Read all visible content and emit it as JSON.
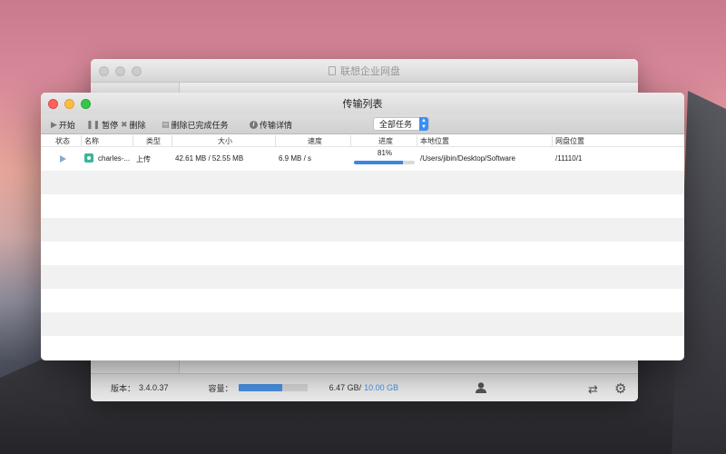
{
  "back_window": {
    "title": "联想企业网盘",
    "footer": {
      "version_label": "版本：",
      "version_value": "3.4.0.37",
      "capacity_label": "容量：",
      "capacity_fraction": 0.64,
      "capacity_used": "6.47 GB/",
      "capacity_total": "10.00 GB"
    }
  },
  "window": {
    "title": "传输列表"
  },
  "toolbar": {
    "start_label": "开始",
    "pause_label": "暂停",
    "delete_label": "删除",
    "delete_completed_label": "删除已完成任务",
    "details_label": "传输详情",
    "filter_value": "全部任务"
  },
  "table": {
    "headers": {
      "status": "状态",
      "name": "名称",
      "type": "类型",
      "size": "大小",
      "speed": "速度",
      "progress": "进度",
      "local_path": "本地位置",
      "cloud_path": "网盘位置"
    },
    "rows": [
      {
        "name": "charles-...",
        "type": "上传",
        "size": "42.61 MB / 52.55 MB",
        "speed": "6.9 MB / s",
        "progress_text": "81%",
        "progress_fraction": 0.81,
        "local_path": "/Users/jibin/Desktop/Software",
        "cloud_path": "/11110/1"
      }
    ]
  },
  "colors": {
    "accent": "#3b86e0",
    "file_icon": "#3bb59a"
  }
}
